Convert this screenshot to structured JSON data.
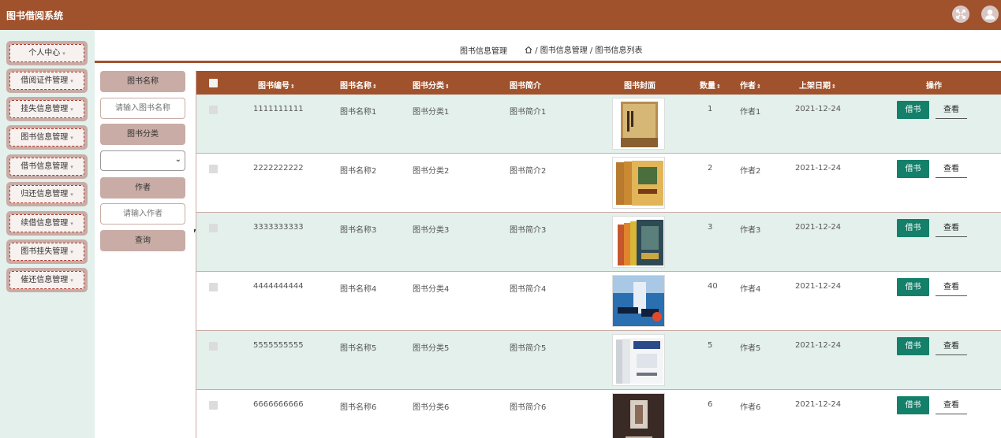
{
  "header": {
    "title": "图书借阅系统",
    "icons": [
      "fullscreen-icon",
      "user-icon"
    ]
  },
  "sidebar": {
    "items": [
      {
        "label": "个人中心"
      },
      {
        "label": "借阅证件管理"
      },
      {
        "label": "挂失信息管理"
      },
      {
        "label": "图书信息管理"
      },
      {
        "label": "借书信息管理"
      },
      {
        "label": "归还信息管理"
      },
      {
        "label": "续借信息管理"
      },
      {
        "label": "图书挂失管理"
      },
      {
        "label": "催还信息管理"
      }
    ]
  },
  "breadcrumb": {
    "title": "图书信息管理",
    "path": "/ 图书信息管理 / 图书信息列表"
  },
  "search": {
    "name_label": "图书名称",
    "name_placeholder": "请输入图书名称",
    "category_label": "图书分类",
    "category_selected": "",
    "author_label": "作者",
    "author_placeholder": "请输入作者",
    "query_button": "查询"
  },
  "table": {
    "columns": [
      {
        "label": "图书编号",
        "sortable": true
      },
      {
        "label": "图书名称",
        "sortable": true
      },
      {
        "label": "图书分类",
        "sortable": true
      },
      {
        "label": "图书简介",
        "sortable": false
      },
      {
        "label": "图书封面",
        "sortable": false
      },
      {
        "label": "数量",
        "sortable": true
      },
      {
        "label": "作者",
        "sortable": true
      },
      {
        "label": "上架日期",
        "sortable": true
      },
      {
        "label": "操作",
        "sortable": false
      }
    ],
    "sort_glyph": "⇕",
    "rows": [
      {
        "id": "1111111111",
        "name": "图书名称1",
        "category": "图书分类1",
        "intro": "图书简介1",
        "qty": "1",
        "author": "作者1",
        "date": "2021-12-24",
        "borrow": "借书",
        "view": "查看"
      },
      {
        "id": "2222222222",
        "name": "图书名称2",
        "category": "图书分类2",
        "intro": "图书简介2",
        "qty": "2",
        "author": "作者2",
        "date": "2021-12-24",
        "borrow": "借书",
        "view": "查看"
      },
      {
        "id": "3333333333",
        "name": "图书名称3",
        "category": "图书分类3",
        "intro": "图书简介3",
        "qty": "3",
        "author": "作者3",
        "date": "2021-12-24",
        "borrow": "借书",
        "view": "查看"
      },
      {
        "id": "4444444444",
        "name": "图书名称4",
        "category": "图书分类4",
        "intro": "图书简介4",
        "qty": "40",
        "author": "作者4",
        "date": "2021-12-24",
        "borrow": "借书",
        "view": "查看"
      },
      {
        "id": "5555555555",
        "name": "图书名称5",
        "category": "图书分类5",
        "intro": "图书简介5",
        "qty": "5",
        "author": "作者5",
        "date": "2021-12-24",
        "borrow": "借书",
        "view": "查看"
      },
      {
        "id": "6666666666",
        "name": "图书名称6",
        "category": "图书分类6",
        "intro": "图书简介6",
        "qty": "6",
        "author": "作者6",
        "date": "2021-12-24",
        "borrow": "借书",
        "view": "查看"
      }
    ]
  },
  "colors": {
    "brand": "#a0522d",
    "sidebar_bg": "#e4f0ec",
    "label_bg": "#c9aca6",
    "borrow_button": "#14806a"
  }
}
